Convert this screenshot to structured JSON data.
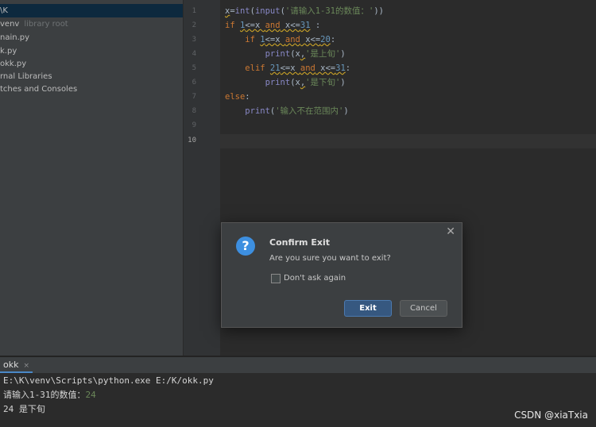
{
  "project": {
    "items": [
      {
        "label": "\\K",
        "hint": ""
      },
      {
        "label": "venv",
        "hint": "library root"
      },
      {
        "label": "nain.py",
        "hint": ""
      },
      {
        "label": "k.py",
        "hint": ""
      },
      {
        "label": "okk.py",
        "hint": ""
      },
      {
        "label": "rnal Libraries",
        "hint": ""
      },
      {
        "label": "tches and Consoles",
        "hint": ""
      }
    ]
  },
  "editor": {
    "line_numbers": [
      "1",
      "2",
      "3",
      "4",
      "5",
      "6",
      "7",
      "8",
      "9",
      "10"
    ],
    "lines": {
      "l1": {
        "a": "x",
        "b": "=",
        "c": "int",
        "d": "(",
        "e": "input",
        "f": "(",
        "g": "'请输入1-31的数值：'",
        "h": "))"
      },
      "l2": {
        "kw": "if",
        "n1": "1",
        "mid": "<=x ",
        "and": "and",
        "rest": " x<=",
        "n2": "31",
        "colon": " :"
      },
      "l3": {
        "kw": "if",
        "n1": "1",
        "mid": "<=x ",
        "and": "and",
        "rest": " x<=",
        "n2": "20",
        "colon": ":"
      },
      "l4": {
        "fn": "print",
        "open": "(x",
        "comma": ",",
        "str": "'是上旬'",
        "close": ")"
      },
      "l5": {
        "kw": "elif",
        "n1": "21",
        "mid": "<=x ",
        "and": "and",
        "rest": " x<=",
        "n2": "31",
        "colon": ":"
      },
      "l6": {
        "fn": "print",
        "open": "(x",
        "comma": ",",
        "str": "'是下旬'",
        "close": ")"
      },
      "l7": {
        "kw": "else",
        "colon": ":"
      },
      "l8": {
        "fn": "print",
        "open": "(",
        "str": "'输入不在范围内'",
        "close": ")"
      }
    }
  },
  "dialog": {
    "title": "Confirm Exit",
    "message": "Are you sure you want to exit?",
    "checkbox_label": "Don't ask again",
    "exit_label": "Exit",
    "cancel_label": "Cancel",
    "icon": "question-icon",
    "icon_glyph": "?",
    "close_glyph": "✕"
  },
  "run": {
    "tab_label": "okk",
    "tab_close": "×",
    "console": {
      "line1": "E:\\K\\venv\\Scripts\\python.exe E:/K/okk.py",
      "prompt": "请输入1-31的数值：",
      "input": "24",
      "result": "24 是下旬"
    }
  },
  "watermark": "CSDN @xiaTxia",
  "colors": {
    "accent": "#365880",
    "keyword": "#cc7832",
    "number": "#6897bb",
    "string": "#6a8759",
    "builtin": "#8888c6"
  }
}
